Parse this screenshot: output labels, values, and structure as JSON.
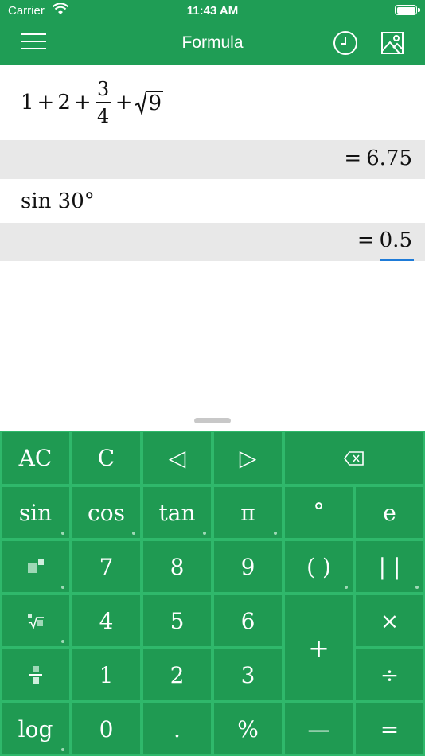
{
  "status": {
    "carrier": "Carrier",
    "time": "11:43 AM"
  },
  "nav": {
    "title": "Formula"
  },
  "entries": [
    {
      "expr": {
        "a": "1",
        "op1": "+",
        "b": "2",
        "op2": "+",
        "num": "3",
        "den": "4",
        "op3": "+",
        "sqrt_arg": "9"
      },
      "result": {
        "eq": "=",
        "value": "6.75"
      }
    },
    {
      "expr_text": "sin 30°",
      "result": {
        "eq": "=",
        "value": "0.5"
      }
    }
  ],
  "keys": {
    "ac": "AC",
    "c": "C",
    "left": "◁",
    "right": "▷",
    "sin": "sin",
    "cos": "cos",
    "tan": "tan",
    "pi": "π",
    "deg": "°",
    "e": "e",
    "k7": "7",
    "k8": "8",
    "k9": "9",
    "paren": "( )",
    "abs": "| |",
    "k4": "4",
    "k5": "5",
    "k6": "6",
    "plus": "+",
    "times": "×",
    "k1": "1",
    "k2": "2",
    "k3": "3",
    "divide": "÷",
    "log": "log",
    "k0": "0",
    "dot": ".",
    "percent": "%",
    "minus": "—",
    "equals": "="
  },
  "colors": {
    "primary": "#1f9d55",
    "key_bg": "#1f9a52",
    "key_border": "#2fb86b",
    "result_bg": "#e8e8e8",
    "cursor": "#1e7bd8"
  },
  "icons": [
    "menu-icon",
    "history-clock-icon",
    "image-icon",
    "backspace-icon",
    "power-icon",
    "sqrt-icon",
    "fraction-icon",
    "wifi-icon",
    "battery-icon"
  ]
}
